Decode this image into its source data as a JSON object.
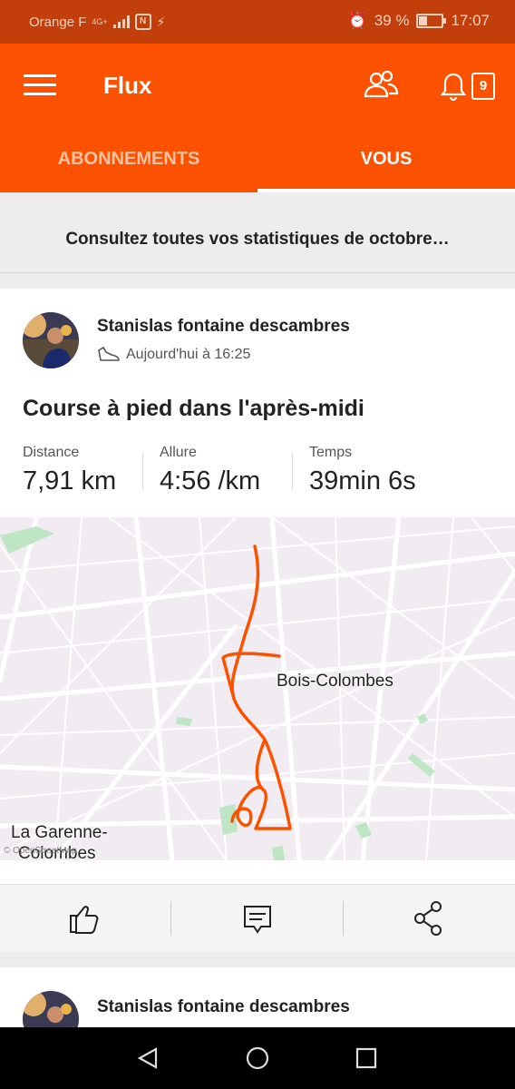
{
  "status_bar": {
    "carrier": "Orange F",
    "network": "4G+",
    "battery": "39 %",
    "time": "17:07"
  },
  "header": {
    "title": "Flux",
    "notification_count": "9",
    "icons": [
      "menu-icon",
      "people-icon",
      "bell-icon",
      "notification-badge"
    ]
  },
  "tabs": [
    {
      "label": "ABONNEMENTS",
      "active": false
    },
    {
      "label": "VOUS",
      "active": true
    }
  ],
  "stats_banner": "Consultez toutes vos statistiques de octobre…",
  "activity": {
    "athlete": "Stanislas fontaine descambres",
    "timestamp": "Aujourd'hui à 16:25",
    "title": "Course à pied dans l'après-midi",
    "stats": [
      {
        "label": "Distance",
        "value": "7,91 km"
      },
      {
        "label": "Allure",
        "value": "4:56 /km"
      },
      {
        "label": "Temps",
        "value": "39min 6s"
      }
    ],
    "map": {
      "labels": [
        "Bois-Colombes",
        "La Garenne-",
        "Colombes"
      ],
      "copyright": "© OpenStreetMap",
      "route_color": "#fc5200"
    },
    "actions": [
      "like-icon",
      "comment-icon",
      "share-icon"
    ]
  },
  "next_activity": {
    "athlete": "Stanislas fontaine descambres"
  },
  "colors": {
    "brand": "#fc5200",
    "status_bar": "#c23e0b"
  }
}
